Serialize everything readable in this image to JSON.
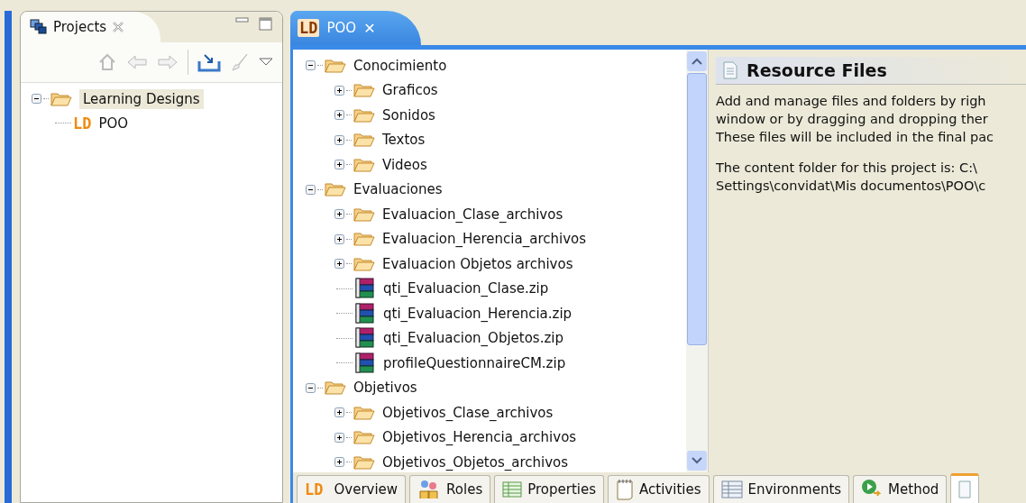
{
  "projects_view": {
    "title": "Projects",
    "tree": [
      {
        "label": "Learning Designs",
        "kind": "folder",
        "expanded": true,
        "selected": true,
        "children": [
          {
            "label": "POO",
            "kind": "ld",
            "badge": "LD",
            "selected": false
          }
        ]
      }
    ]
  },
  "editor": {
    "tab": {
      "badge": "LD",
      "title": "POO",
      "close": "✕"
    },
    "tree": [
      {
        "label": "Conocimiento",
        "kind": "folder",
        "expanded": true,
        "children": [
          {
            "label": "Graficos",
            "kind": "folder",
            "expanded": false
          },
          {
            "label": "Sonidos",
            "kind": "folder",
            "expanded": false
          },
          {
            "label": "Textos",
            "kind": "folder",
            "expanded": false
          },
          {
            "label": "Videos",
            "kind": "folder",
            "expanded": false
          }
        ]
      },
      {
        "label": "Evaluaciones",
        "kind": "folder",
        "expanded": true,
        "children": [
          {
            "label": "Evaluacion_Clase_archivos",
            "kind": "folder",
            "expanded": false
          },
          {
            "label": "Evaluacion_Herencia_archivos",
            "kind": "folder",
            "expanded": false
          },
          {
            "label": "Evaluacion Objetos archivos",
            "kind": "folder",
            "expanded": false
          },
          {
            "label": "qti_Evaluacion_Clase.zip",
            "kind": "zip"
          },
          {
            "label": "qti_Evaluacion_Herencia.zip",
            "kind": "zip"
          },
          {
            "label": "qti_Evaluacion_Objetos.zip",
            "kind": "zip"
          },
          {
            "label": "profileQuestionnaireCM.zip",
            "kind": "zip"
          }
        ]
      },
      {
        "label": "Objetivos",
        "kind": "folder",
        "expanded": true,
        "children": [
          {
            "label": "Objetivos_Clase_archivos",
            "kind": "folder",
            "expanded": false
          },
          {
            "label": "Objetivos_Herencia_archivos",
            "kind": "folder",
            "expanded": false
          },
          {
            "label": "Objetivos_Objetos_archivos",
            "kind": "folder",
            "expanded": false
          }
        ]
      }
    ],
    "section": {
      "title": "Resource Files",
      "paragraphs": [
        [
          "Add and manage files and folders by righ",
          "window or by dragging and dropping ther",
          "These files will be included in the final pac"
        ],
        [
          "The content folder for this project is:  C:\\",
          "Settings\\convidat\\Mis documentos\\POO\\c"
        ]
      ]
    },
    "page_tabs": [
      {
        "label": "Overview",
        "kind": "ld",
        "badge": "LD",
        "selected": false
      },
      {
        "label": "Roles",
        "kind": "roles",
        "selected": false
      },
      {
        "label": "Properties",
        "kind": "properties",
        "selected": false
      },
      {
        "label": "Activities",
        "kind": "activities",
        "selected": false
      },
      {
        "label": "Environments",
        "kind": "environments",
        "selected": false
      },
      {
        "label": "Method",
        "kind": "method",
        "selected": false
      },
      {
        "kind": "resources",
        "selected": true
      }
    ]
  }
}
